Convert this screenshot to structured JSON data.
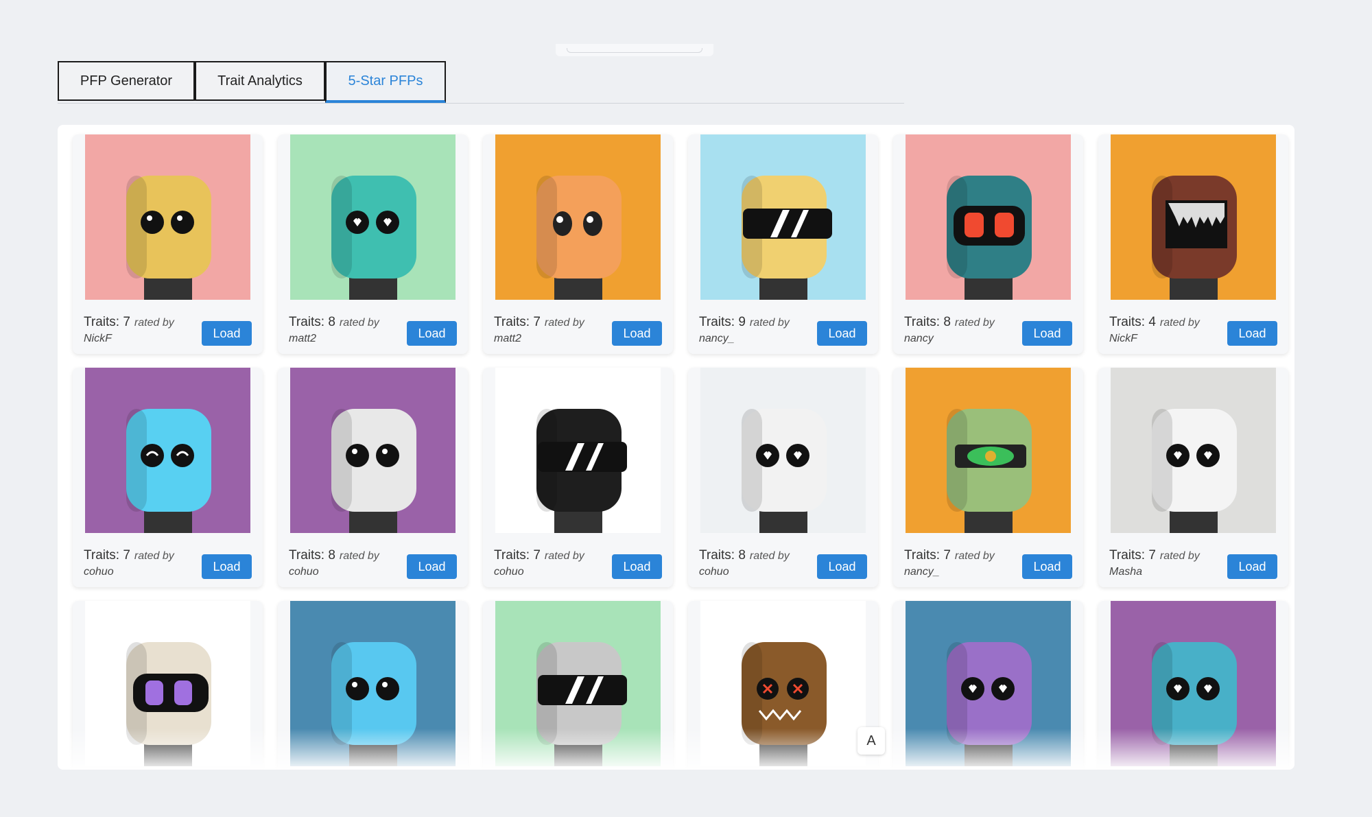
{
  "tabs": [
    {
      "label": "PFP Generator",
      "active": false
    },
    {
      "label": "Trait Analytics",
      "active": false
    },
    {
      "label": "5-Star PFPs",
      "active": true
    }
  ],
  "rated_by_label": "rated by",
  "load_label": "Load",
  "overlay_button_label": "A",
  "colors": {
    "accent": "#2b84d8"
  },
  "cards": [
    {
      "traits": "Traits: 7",
      "user": "NickF",
      "bg": "#f2a7a5",
      "head": "#e8c35a",
      "eyes": "plain"
    },
    {
      "traits": "Traits: 8",
      "user": "matt2",
      "bg": "#a8e3b8",
      "head": "#3fbfb0",
      "eyes": "heart"
    },
    {
      "traits": "Traits: 7",
      "user": "matt2",
      "bg": "#f0a030",
      "head": "#f4a05a",
      "eyes": "anime"
    },
    {
      "traits": "Traits: 9",
      "user": "nancy_",
      "bg": "#a8e0f0",
      "head": "#f0d070",
      "eyes": "visor"
    },
    {
      "traits": "Traits: 8",
      "user": "nancy",
      "bg": "#f2a7a5",
      "head": "#2f7f86",
      "eyes": "red"
    },
    {
      "traits": "Traits: 4",
      "user": "NickF",
      "bg": "#f0a030",
      "head": "#7a3a2a",
      "eyes": "screen"
    },
    {
      "traits": "Traits: 7",
      "user": "cohuo",
      "bg": "#9a62a8",
      "head": "#58d0f2",
      "eyes": "smile"
    },
    {
      "traits": "Traits: 8",
      "user": "cohuo",
      "bg": "#9a62a8",
      "head": "#e8e8e8",
      "eyes": "plain"
    },
    {
      "traits": "Traits: 7",
      "user": "cohuo",
      "bg": "#ffffff",
      "head": "#1e1e1e",
      "eyes": "visor"
    },
    {
      "traits": "Traits: 8",
      "user": "cohuo",
      "bg": "#eef1f3",
      "head": "#f2f2f2",
      "eyes": "heart"
    },
    {
      "traits": "Traits: 7",
      "user": "nancy_",
      "bg": "#f0a030",
      "head": "#9abf7a",
      "eyes": "cyclops"
    },
    {
      "traits": "Traits: 7",
      "user": "Masha",
      "bg": "#dededc",
      "head": "#f4f4f4",
      "eyes": "heart"
    },
    {
      "traits": "",
      "user": "",
      "bg": "#ffffff",
      "head": "#e8e0d0",
      "eyes": "goggle"
    },
    {
      "traits": "",
      "user": "",
      "bg": "#4a8ab0",
      "head": "#58c8f0",
      "eyes": "plain"
    },
    {
      "traits": "",
      "user": "",
      "bg": "#a8e3b8",
      "head": "#c8c8c8",
      "eyes": "visor"
    },
    {
      "traits": "",
      "user": "",
      "bg": "#ffffff",
      "head": "#8a5a2a",
      "eyes": "x"
    },
    {
      "traits": "",
      "user": "",
      "bg": "#4a8ab0",
      "head": "#9a70c8",
      "eyes": "heart"
    },
    {
      "traits": "",
      "user": "",
      "bg": "#9a62a8",
      "head": "#48b0c8",
      "eyes": "heart"
    }
  ]
}
